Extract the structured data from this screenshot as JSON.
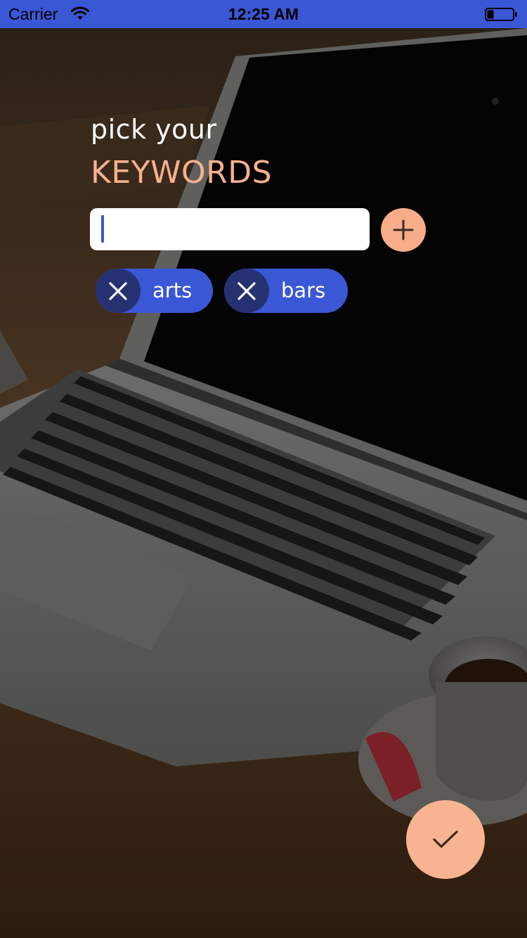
{
  "status_bar": {
    "carrier": "Carrier",
    "time": "12:25 AM",
    "wifi_icon": "wifi-icon",
    "battery_icon": "battery-icon",
    "color": "#3a57d6"
  },
  "background": {
    "icon": "laptop-coffee-photo"
  },
  "header": {
    "subtitle": "pick your",
    "title": "KEYWORDS",
    "title_color": "#f7b08e"
  },
  "keyword_input": {
    "value": "",
    "placeholder": ""
  },
  "add_button": {
    "icon": "plus-icon",
    "color": "#f8ad88"
  },
  "keywords": [
    {
      "label": "arts",
      "remove_icon": "close-icon"
    },
    {
      "label": "bars",
      "remove_icon": "close-icon"
    }
  ],
  "chip_colors": {
    "body": "#3a57d6",
    "remove": "#263172"
  },
  "confirm_button": {
    "icon": "checkmark-icon",
    "color": "#f8b490"
  }
}
